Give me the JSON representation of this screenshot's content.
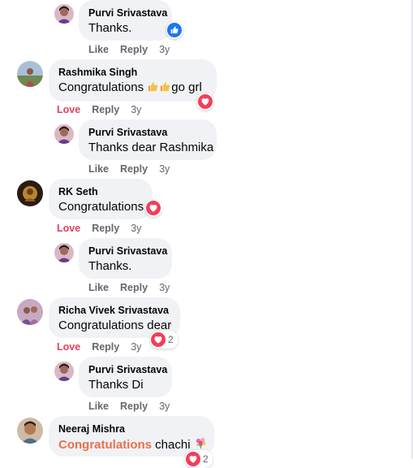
{
  "colors": {
    "bubble": "#f0f2f5",
    "love": "#e4405f",
    "like": "#1877f2",
    "highlight": "#e9704c",
    "meta": "#65676b"
  },
  "comments": [
    {
      "author": "Purvi Srivastava",
      "text": "Thanks.",
      "actions": [
        "Like",
        "Reply"
      ],
      "time": "3y",
      "reaction": "like-icon",
      "reaction_count": ""
    },
    {
      "author": "Rashmika Singh",
      "text": "Congratulations",
      "text_suffix": "go grl",
      "emojis": [
        "thumbs-up-icon",
        "thumbs-up-icon"
      ],
      "actions": [
        "Love",
        "Reply"
      ],
      "time": "3y",
      "reaction": "heart-icon",
      "reaction_count": ""
    },
    {
      "author": "Purvi Srivastava",
      "text": "Thanks dear Rashmika",
      "actions": [
        "Like",
        "Reply"
      ],
      "time": "3y"
    },
    {
      "author": "RK Seth",
      "text": "Congratulations",
      "actions": [
        "Love",
        "Reply"
      ],
      "time": "3y",
      "reaction": "heart-icon",
      "reaction_count": ""
    },
    {
      "author": "Purvi Srivastava",
      "text": "Thanks.",
      "actions": [
        "Like",
        "Reply"
      ],
      "time": "3y"
    },
    {
      "author": "Richa Vivek Srivastava",
      "text": "Congratulations dear",
      "actions": [
        "Love",
        "Reply"
      ],
      "time": "3y",
      "reaction": "heart-icon",
      "reaction_count": "2"
    },
    {
      "author": "Purvi Srivastava",
      "text": "Thanks Di",
      "actions": [
        "Like",
        "Reply"
      ],
      "time": "3y"
    },
    {
      "author": "Neeraj Mishra",
      "text_highlight": "Congratulations",
      "text": "chachi",
      "emojis": [
        "bouquet-icon"
      ],
      "reaction": "heart-icon",
      "reaction_count": "2"
    }
  ]
}
